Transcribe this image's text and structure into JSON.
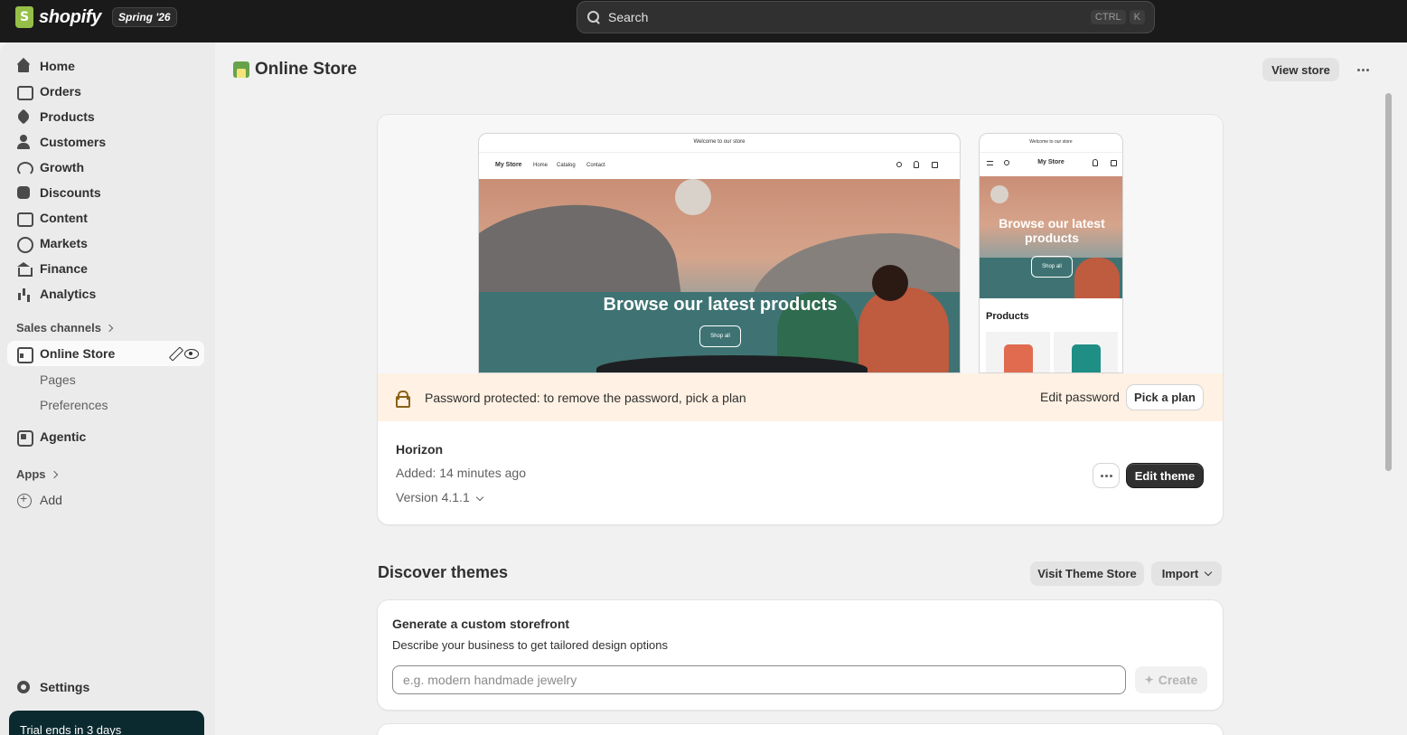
{
  "topbar": {
    "logo_text": "shopify",
    "edition": "Spring '26",
    "search_placeholder": "Search",
    "shortcut_ctrl": "CTRL",
    "shortcut_key": "K"
  },
  "sidebar": {
    "items": [
      {
        "label": "Home",
        "icon": "home-icon"
      },
      {
        "label": "Orders",
        "icon": "orders-icon"
      },
      {
        "label": "Products",
        "icon": "tag-icon"
      },
      {
        "label": "Customers",
        "icon": "person-icon"
      },
      {
        "label": "Growth",
        "icon": "gauge-icon"
      },
      {
        "label": "Discounts",
        "icon": "discount-icon"
      },
      {
        "label": "Content",
        "icon": "content-icon"
      },
      {
        "label": "Markets",
        "icon": "globe-icon"
      },
      {
        "label": "Finance",
        "icon": "bank-icon"
      },
      {
        "label": "Analytics",
        "icon": "bar-chart-icon"
      }
    ],
    "sales_channels_label": "Sales channels",
    "online_store": {
      "label": "Online Store",
      "icon": "store-icon"
    },
    "sub_items": [
      "Pages",
      "Preferences"
    ],
    "agentic": {
      "label": "Agentic",
      "icon": "agentic-icon"
    },
    "apps_label": "Apps",
    "add_label": "Add",
    "settings_label": "Settings",
    "trial_text": "Trial ends in 3 days"
  },
  "page": {
    "title": "Online Store",
    "view_store": "View store"
  },
  "theme": {
    "preview": {
      "announcement": "Welcome to our store",
      "store_name": "My Store",
      "nav": [
        "Home",
        "Catalog",
        "Contact"
      ],
      "hero_title": "Browse our latest products",
      "hero_button": "Shop all",
      "mobile_products_heading": "Products"
    },
    "banner_text": "Password protected: to remove the password, pick a plan",
    "edit_password": "Edit password",
    "pick_plan": "Pick a plan",
    "name": "Horizon",
    "added": "Added: 14 minutes ago",
    "version": "Version 4.1.1",
    "edit_theme": "Edit theme"
  },
  "discover": {
    "heading": "Discover themes",
    "visit_store": "Visit Theme Store",
    "import": "Import",
    "generate": {
      "title": "Generate a custom storefront",
      "subtitle": "Describe your business to get tailored design options",
      "placeholder": "e.g. modern handmade jewelry",
      "create": "Create"
    }
  },
  "colors": {
    "topbar": "#1a1a1a",
    "sidebar": "#ebebeb",
    "banner": "#fff1e3",
    "primary_button": "#303030",
    "trial_panel": "#0b2a2f"
  }
}
